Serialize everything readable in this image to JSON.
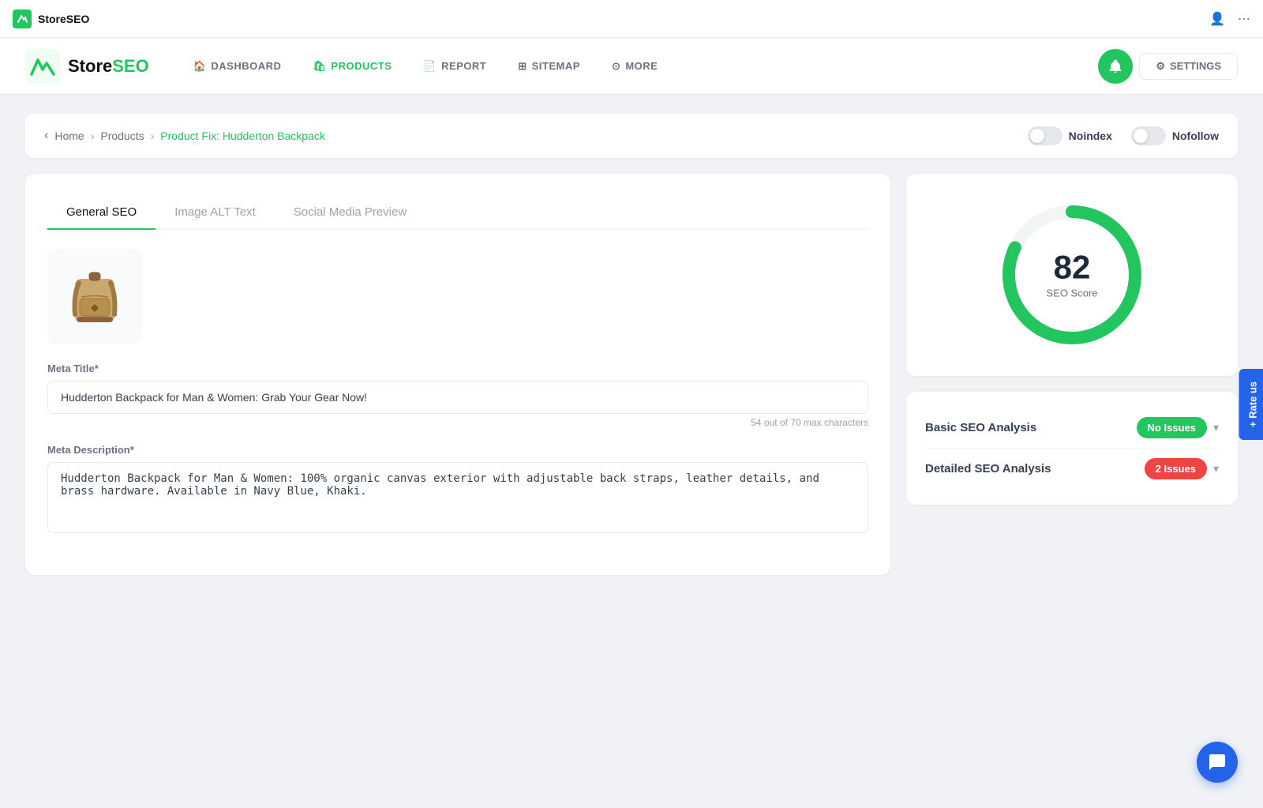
{
  "titleBar": {
    "appName": "StoreSEO",
    "icons": {
      "user": "👤",
      "more": "⋯"
    }
  },
  "nav": {
    "logo": {
      "text1": "Store",
      "text2": "SEO"
    },
    "items": [
      {
        "id": "dashboard",
        "label": "DASHBOARD",
        "icon": "🏠"
      },
      {
        "id": "products",
        "label": "PRODUCTS",
        "icon": "🛍",
        "active": true
      },
      {
        "id": "report",
        "label": "REPORT",
        "icon": "📄"
      },
      {
        "id": "sitemap",
        "label": "SITEMAP",
        "icon": "⊞"
      },
      {
        "id": "more",
        "label": "MORE",
        "icon": "⊙"
      }
    ],
    "settings": {
      "label": "SETTINGS",
      "icon": "⚙"
    }
  },
  "breadcrumb": {
    "back": "‹",
    "items": [
      {
        "label": "Home",
        "active": false
      },
      {
        "label": "Products",
        "active": false
      },
      {
        "label": "Product Fix: Hudderton Backpack",
        "active": true
      }
    ],
    "noindex": "Noindex",
    "nofollow": "Nofollow"
  },
  "tabs": [
    {
      "label": "General SEO",
      "active": true
    },
    {
      "label": "Image ALT Text",
      "active": false
    },
    {
      "label": "Social Media Preview",
      "active": false
    }
  ],
  "form": {
    "metaTitleLabel": "Meta Title*",
    "metaTitleValue": "Hudderton Backpack for Man & Women: Grab Your Gear Now!",
    "metaTitleHint": "54 out of 70 max characters",
    "metaDescLabel": "Meta Description*",
    "metaDescValue": "Hudderton Backpack for Man & Women: 100% organic canvas exterior with adjustable back straps, leather details, and brass hardware. Available in Navy Blue, Khaki."
  },
  "seoScore": {
    "score": "82",
    "label": "SEO Score",
    "circumference": 502.65,
    "dashoffset": 90
  },
  "analysis": [
    {
      "label": "Basic SEO Analysis",
      "badgeType": "green",
      "badgeLabel": "No Issues"
    },
    {
      "label": "Detailed SEO Analysis",
      "badgeType": "red",
      "badgeLabel": "2 Issues"
    }
  ],
  "rateUs": "+ Rate us",
  "chat": "💬"
}
